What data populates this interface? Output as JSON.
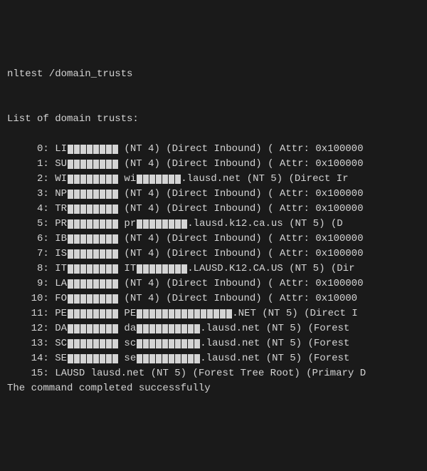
{
  "command": "nltest /domain_trusts",
  "header": "List of domain trusts:",
  "rows": [
    {
      "idx": "0",
      "pre": "LI",
      "red1": 8,
      "mid": " (NT 4) (Direct Inbound) ( Attr: 0x100000",
      "red2": 0,
      "mid2": "",
      "red3": 0,
      "tail": ""
    },
    {
      "idx": "1",
      "pre": "SU",
      "red1": 8,
      "mid": " (NT 4) (Direct Inbound) ( Attr: 0x100000",
      "red2": 0,
      "mid2": "",
      "red3": 0,
      "tail": ""
    },
    {
      "idx": "2",
      "pre": "WI",
      "red1": 8,
      "mid": " wi",
      "red2": 7,
      "mid2": ".lausd.net (NT 5) (Direct Ir",
      "red3": 0,
      "tail": ""
    },
    {
      "idx": "3",
      "pre": "NP",
      "red1": 8,
      "mid": " (NT 4) (Direct Inbound) ( Attr: 0x100000",
      "red2": 0,
      "mid2": "",
      "red3": 0,
      "tail": ""
    },
    {
      "idx": "4",
      "pre": "TR",
      "red1": 8,
      "mid": " (NT 4) (Direct Inbound) ( Attr: 0x100000",
      "red2": 0,
      "mid2": "",
      "red3": 0,
      "tail": ""
    },
    {
      "idx": "5",
      "pre": "PR",
      "red1": 8,
      "mid": " pr",
      "red2": 8,
      "mid2": ".lausd.k12.ca.us (NT 5) (D",
      "red3": 0,
      "tail": ""
    },
    {
      "idx": "6",
      "pre": "IB",
      "red1": 8,
      "mid": " (NT 4) (Direct Inbound) ( Attr: 0x100000",
      "red2": 0,
      "mid2": "",
      "red3": 0,
      "tail": ""
    },
    {
      "idx": "7",
      "pre": "IS",
      "red1": 8,
      "mid": " (NT 4) (Direct Inbound) ( Attr: 0x100000",
      "red2": 0,
      "mid2": "",
      "red3": 0,
      "tail": ""
    },
    {
      "idx": "8",
      "pre": "IT",
      "red1": 8,
      "mid": " IT",
      "red2": 8,
      "mid2": ".LAUSD.K12.CA.US (NT 5) (Dir",
      "red3": 0,
      "tail": ""
    },
    {
      "idx": "9",
      "pre": "LA",
      "red1": 8,
      "mid": " (NT 4) (Direct Inbound) ( Attr: 0x100000",
      "red2": 0,
      "mid2": "",
      "red3": 0,
      "tail": ""
    },
    {
      "idx": "10",
      "pre": "FO",
      "red1": 8,
      "mid": " (NT 4) (Direct Inbound) ( Attr: 0x10000",
      "red2": 0,
      "mid2": "",
      "red3": 0,
      "tail": ""
    },
    {
      "idx": "11",
      "pre": "PE",
      "red1": 8,
      "mid": " PE",
      "red2": 15,
      "mid2": ".NET (NT 5) (Direct I",
      "red3": 0,
      "tail": ""
    },
    {
      "idx": "12",
      "pre": "DA",
      "red1": 8,
      "mid": " da",
      "red2": 10,
      "mid2": ".lausd.net (NT 5) (Forest",
      "red3": 0,
      "tail": ""
    },
    {
      "idx": "13",
      "pre": "SC",
      "red1": 8,
      "mid": " sc",
      "red2": 10,
      "mid2": ".lausd.net (NT 5) (Forest",
      "red3": 0,
      "tail": ""
    },
    {
      "idx": "14",
      "pre": "SE",
      "red1": 8,
      "mid": " se",
      "red2": 10,
      "mid2": ".lausd.net (NT 5) (Forest",
      "red3": 0,
      "tail": ""
    },
    {
      "idx": "15",
      "pre": "LAUSD lausd.net (NT 5) (Forest Tree Root) (Primary D",
      "red1": 0,
      "mid": "",
      "red2": 0,
      "mid2": "",
      "red3": 0,
      "tail": ""
    }
  ],
  "footer": "The command completed successfully"
}
